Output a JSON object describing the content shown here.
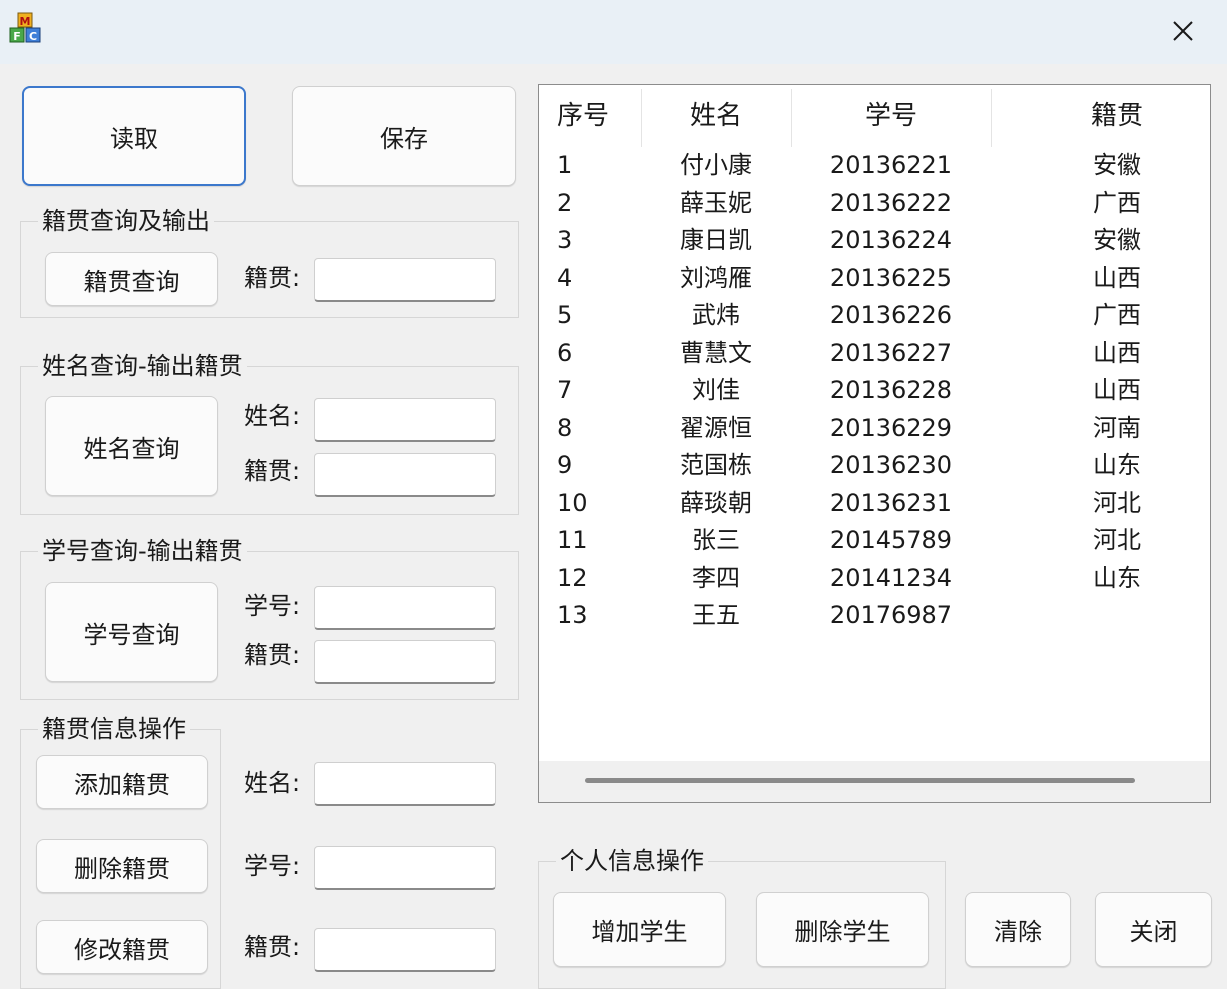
{
  "window": {
    "title": "",
    "app_icon": "mfc-app-icon",
    "close_icon": "close-icon"
  },
  "buttons": {
    "read": "读取",
    "save": "保存",
    "origin_query": "籍贯查询",
    "name_query": "姓名查询",
    "id_query": "学号查询",
    "add_origin": "添加籍贯",
    "delete_origin": "删除籍贯",
    "modify_origin": "修改籍贯",
    "add_student": "增加学生",
    "delete_student": "删除学生",
    "clear": "清除",
    "close": "关闭"
  },
  "groups": {
    "origin_query_output": "籍贯查询及输出",
    "name_query_output": "姓名查询-输出籍贯",
    "id_query_output": "学号查询-输出籍贯",
    "origin_info_ops": "籍贯信息操作",
    "personal_info_ops": "个人信息操作"
  },
  "labels": {
    "origin": "籍贯:",
    "name": "姓名:",
    "student_id": "学号:"
  },
  "fields": {
    "origin_query_origin": "",
    "name_query_name": "",
    "name_query_origin": "",
    "id_query_id": "",
    "id_query_origin": "",
    "ops_name": "",
    "ops_id": "",
    "ops_origin": ""
  },
  "table": {
    "columns": [
      "序号",
      "姓名",
      "学号",
      "籍贯"
    ],
    "rows": [
      [
        "1",
        "付小康",
        "20136221",
        "安徽"
      ],
      [
        "2",
        "薛玉妮",
        "20136222",
        "广西"
      ],
      [
        "3",
        "康日凯",
        "20136224",
        "安徽"
      ],
      [
        "4",
        "刘鸿雁",
        "20136225",
        "山西"
      ],
      [
        "5",
        "武炜",
        "20136226",
        "广西"
      ],
      [
        "6",
        "曹慧文",
        "20136227",
        "山西"
      ],
      [
        "7",
        "刘佳",
        "20136228",
        "山西"
      ],
      [
        "8",
        "翟源恒",
        "20136229",
        "河南"
      ],
      [
        "9",
        "范国栋",
        "20136230",
        "山东"
      ],
      [
        "10",
        "薛琰朝",
        "20136231",
        "河北"
      ],
      [
        "11",
        "张三",
        "20145789",
        "河北"
      ],
      [
        "12",
        "李四",
        "20141234",
        "山东"
      ],
      [
        "13",
        "王五",
        "20176987",
        ""
      ]
    ]
  },
  "colors": {
    "accent": "#3c78cc",
    "titlebar": "#e9f0f6",
    "background": "#f0f0f0"
  }
}
